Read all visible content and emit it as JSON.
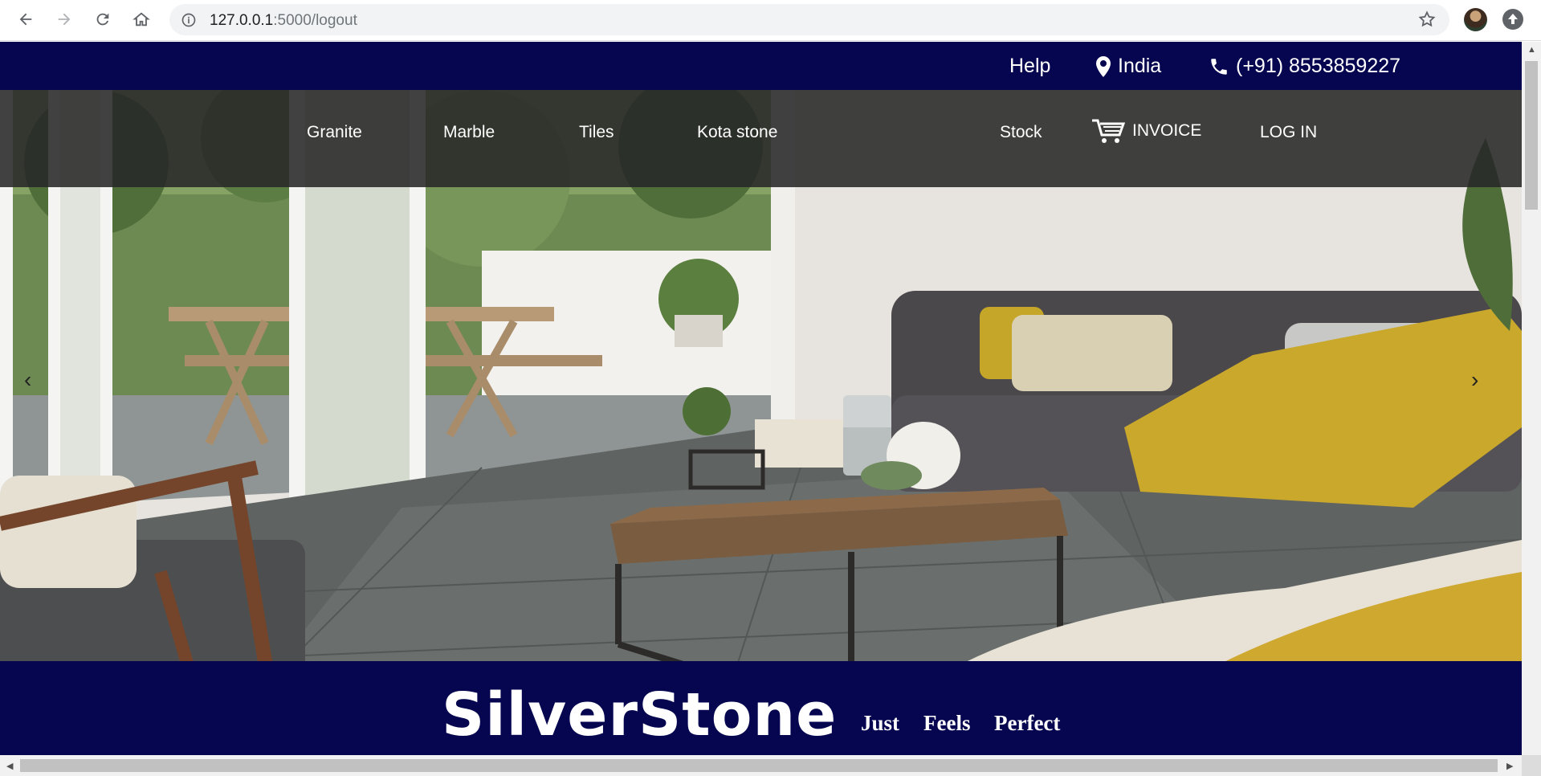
{
  "browser": {
    "url_host": "127.0.0.1",
    "url_path": ":5000/logout"
  },
  "topbar": {
    "help": "Help",
    "location": "India",
    "phone": "(+91) 8553859227",
    "background": "#05064f"
  },
  "nav": {
    "links": [
      "Granite",
      "Marble",
      "Tiles",
      "Kota stone",
      "Stock"
    ],
    "invoice": "INVOICE",
    "login": "LOG IN"
  },
  "carousel": {
    "prev": "‹",
    "next": "›"
  },
  "brand": {
    "name": "SilverStone",
    "tagline": [
      "Just",
      "Feels",
      "Perfect"
    ]
  },
  "icons": [
    "back-arrow-icon",
    "forward-arrow-icon",
    "reload-icon",
    "home-icon",
    "info-icon",
    "star-icon",
    "map-pin-icon",
    "phone-icon",
    "cart-icon"
  ]
}
